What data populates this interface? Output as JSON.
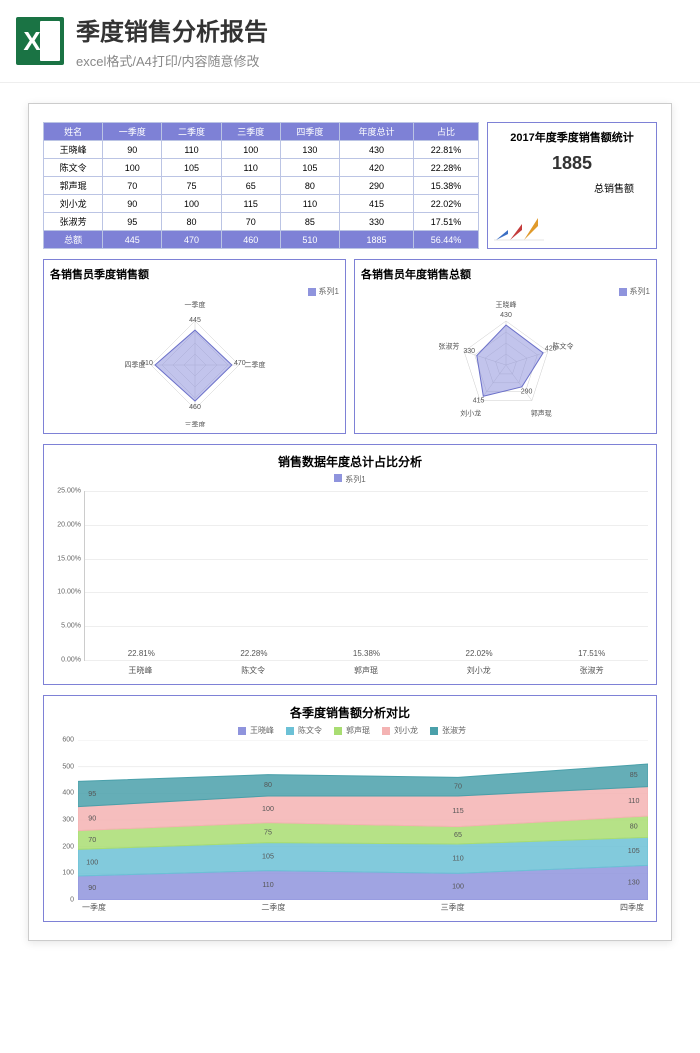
{
  "header": {
    "title": "季度销售分析报告",
    "subtitle": "excel格式/A4打印/内容随意修改",
    "icon_letter": "X"
  },
  "table": {
    "columns": [
      "姓名",
      "一季度",
      "二季度",
      "三季度",
      "四季度",
      "年度总计",
      "占比"
    ],
    "rows": [
      {
        "name": "王晓峰",
        "q1": 90,
        "q2": 110,
        "q3": 100,
        "q4": 130,
        "total": 430,
        "pct": "22.81%"
      },
      {
        "name": "陈文令",
        "q1": 100,
        "q2": 105,
        "q3": 110,
        "q4": 105,
        "total": 420,
        "pct": "22.28%"
      },
      {
        "name": "郭声琨",
        "q1": 70,
        "q2": 75,
        "q3": 65,
        "q4": 80,
        "total": 290,
        "pct": "15.38%"
      },
      {
        "name": "刘小龙",
        "q1": 90,
        "q2": 100,
        "q3": 115,
        "q4": 110,
        "total": 415,
        "pct": "22.02%"
      },
      {
        "name": "张淑芳",
        "q1": 95,
        "q2": 80,
        "q3": 70,
        "q4": 85,
        "total": 330,
        "pct": "17.51%"
      }
    ],
    "total_row": {
      "label": "总额",
      "q1": 445,
      "q2": 470,
      "q3": 460,
      "q4": 510,
      "total": 1885,
      "pct": "56.44%"
    }
  },
  "summary": {
    "title": "2017年度季度销售额统计",
    "value": "1885",
    "label": "总销售额"
  },
  "radar1": {
    "title": "各销售员季度销售额",
    "legend": "系列1",
    "axes": [
      "一季度",
      "二季度",
      "三季度",
      "四季度"
    ],
    "values": [
      445,
      470,
      460,
      510
    ]
  },
  "radar2": {
    "title": "各销售员年度销售总额",
    "legend": "系列1",
    "axes": [
      "王晓峰",
      "陈文令",
      "郭声琨",
      "刘小龙",
      "张淑芳"
    ],
    "values": [
      430,
      420,
      290,
      415,
      330
    ]
  },
  "chart_data": [
    {
      "type": "bar",
      "title": "销售数据年度总计占比分析",
      "legend": "系列1",
      "categories": [
        "王晓峰",
        "陈文令",
        "郭声琨",
        "刘小龙",
        "张淑芳"
      ],
      "values": [
        22.81,
        22.28,
        15.38,
        22.02,
        17.51
      ],
      "labels": [
        "22.81%",
        "22.28%",
        "15.38%",
        "22.02%",
        "17.51%"
      ],
      "ylim": [
        0,
        25
      ],
      "yticks": [
        "0.00%",
        "5.00%",
        "10.00%",
        "15.00%",
        "20.00%",
        "25.00%"
      ]
    },
    {
      "type": "area",
      "title": "各季度销售额分析对比",
      "categories": [
        "一季度",
        "二季度",
        "三季度",
        "四季度"
      ],
      "series": [
        {
          "name": "王晓峰",
          "color": "#8f94dd",
          "values": [
            90,
            110,
            100,
            130
          ]
        },
        {
          "name": "陈文令",
          "color": "#6cc1d6",
          "values": [
            100,
            105,
            110,
            105
          ]
        },
        {
          "name": "郭声琨",
          "color": "#a9dd72",
          "values": [
            70,
            75,
            65,
            80
          ]
        },
        {
          "name": "刘小龙",
          "color": "#f4b3b3",
          "values": [
            90,
            100,
            115,
            110
          ]
        },
        {
          "name": "张淑芳",
          "color": "#4aa0aa",
          "values": [
            95,
            80,
            70,
            85
          ]
        }
      ],
      "ylim": [
        0,
        600
      ],
      "yticks": [
        0,
        100,
        200,
        300,
        400,
        500,
        600
      ],
      "stack_labels": [
        {
          "q": 0,
          "vals": [
            90,
            100,
            70,
            90,
            95
          ]
        },
        {
          "q": 1,
          "vals": [
            110,
            105,
            75,
            100,
            80
          ]
        },
        {
          "q": 2,
          "vals": [
            100,
            110,
            65,
            115,
            70
          ]
        },
        {
          "q": 3,
          "vals": [
            130,
            105,
            80,
            110,
            85
          ]
        }
      ]
    }
  ]
}
